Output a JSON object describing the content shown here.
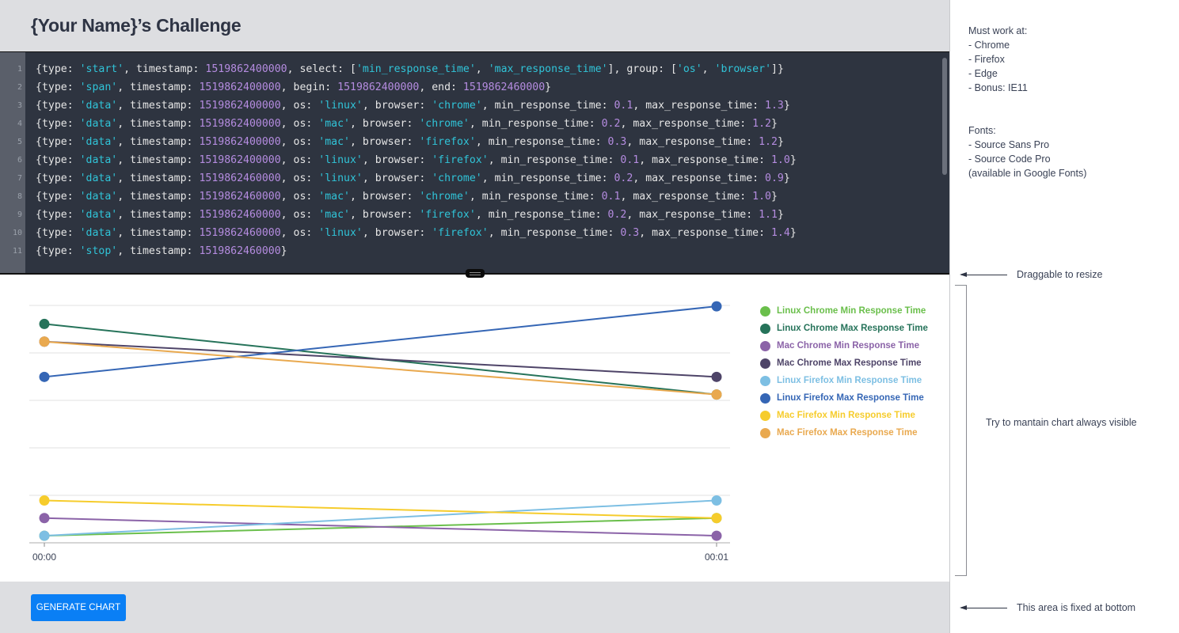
{
  "header": {
    "title": "{Your Name}’s Challenge"
  },
  "editor": {
    "lines": [
      [
        [
          "p",
          "{type: "
        ],
        [
          "s",
          "'start'"
        ],
        [
          "p",
          ", timestamp: "
        ],
        [
          "n",
          "1519862400000"
        ],
        [
          "p",
          ", select: ["
        ],
        [
          "s",
          "'min_response_time'"
        ],
        [
          "p",
          ", "
        ],
        [
          "s",
          "'max_response_time'"
        ],
        [
          "p",
          "], group: ["
        ],
        [
          "s",
          "'os'"
        ],
        [
          "p",
          ", "
        ],
        [
          "s",
          "'browser'"
        ],
        [
          "p",
          "]}"
        ]
      ],
      [
        [
          "p",
          "{type: "
        ],
        [
          "s",
          "'span'"
        ],
        [
          "p",
          ", timestamp: "
        ],
        [
          "n",
          "1519862400000"
        ],
        [
          "p",
          ", begin: "
        ],
        [
          "n",
          "1519862400000"
        ],
        [
          "p",
          ", end: "
        ],
        [
          "n",
          "1519862460000"
        ],
        [
          "p",
          "}"
        ]
      ],
      [
        [
          "p",
          "{type: "
        ],
        [
          "s",
          "'data'"
        ],
        [
          "p",
          ", timestamp: "
        ],
        [
          "n",
          "1519862400000"
        ],
        [
          "p",
          ", os: "
        ],
        [
          "s",
          "'linux'"
        ],
        [
          "p",
          ", browser: "
        ],
        [
          "s",
          "'chrome'"
        ],
        [
          "p",
          ", min_response_time: "
        ],
        [
          "n",
          "0.1"
        ],
        [
          "p",
          ", max_response_time: "
        ],
        [
          "n",
          "1.3"
        ],
        [
          "p",
          "}"
        ]
      ],
      [
        [
          "p",
          "{type: "
        ],
        [
          "s",
          "'data'"
        ],
        [
          "p",
          ", timestamp: "
        ],
        [
          "n",
          "1519862400000"
        ],
        [
          "p",
          ", os: "
        ],
        [
          "s",
          "'mac'"
        ],
        [
          "p",
          ", browser: "
        ],
        [
          "s",
          "'chrome'"
        ],
        [
          "p",
          ", min_response_time: "
        ],
        [
          "n",
          "0.2"
        ],
        [
          "p",
          ", max_response_time: "
        ],
        [
          "n",
          "1.2"
        ],
        [
          "p",
          "}"
        ]
      ],
      [
        [
          "p",
          "{type: "
        ],
        [
          "s",
          "'data'"
        ],
        [
          "p",
          ", timestamp: "
        ],
        [
          "n",
          "1519862400000"
        ],
        [
          "p",
          ", os: "
        ],
        [
          "s",
          "'mac'"
        ],
        [
          "p",
          ", browser: "
        ],
        [
          "s",
          "'firefox'"
        ],
        [
          "p",
          ", min_response_time: "
        ],
        [
          "n",
          "0.3"
        ],
        [
          "p",
          ", max_response_time: "
        ],
        [
          "n",
          "1.2"
        ],
        [
          "p",
          "}"
        ]
      ],
      [
        [
          "p",
          "{type: "
        ],
        [
          "s",
          "'data'"
        ],
        [
          "p",
          ", timestamp: "
        ],
        [
          "n",
          "1519862400000"
        ],
        [
          "p",
          ", os: "
        ],
        [
          "s",
          "'linux'"
        ],
        [
          "p",
          ", browser: "
        ],
        [
          "s",
          "'firefox'"
        ],
        [
          "p",
          ", min_response_time: "
        ],
        [
          "n",
          "0.1"
        ],
        [
          "p",
          ", max_response_time: "
        ],
        [
          "n",
          "1.0"
        ],
        [
          "p",
          "}"
        ]
      ],
      [
        [
          "p",
          "{type: "
        ],
        [
          "s",
          "'data'"
        ],
        [
          "p",
          ", timestamp: "
        ],
        [
          "n",
          "1519862460000"
        ],
        [
          "p",
          ", os: "
        ],
        [
          "s",
          "'linux'"
        ],
        [
          "p",
          ", browser: "
        ],
        [
          "s",
          "'chrome'"
        ],
        [
          "p",
          ", min_response_time: "
        ],
        [
          "n",
          "0.2"
        ],
        [
          "p",
          ", max_response_time: "
        ],
        [
          "n",
          "0.9"
        ],
        [
          "p",
          "}"
        ]
      ],
      [
        [
          "p",
          "{type: "
        ],
        [
          "s",
          "'data'"
        ],
        [
          "p",
          ", timestamp: "
        ],
        [
          "n",
          "1519862460000"
        ],
        [
          "p",
          ", os: "
        ],
        [
          "s",
          "'mac'"
        ],
        [
          "p",
          ", browser: "
        ],
        [
          "s",
          "'chrome'"
        ],
        [
          "p",
          ", min_response_time: "
        ],
        [
          "n",
          "0.1"
        ],
        [
          "p",
          ", max_response_time: "
        ],
        [
          "n",
          "1.0"
        ],
        [
          "p",
          "}"
        ]
      ],
      [
        [
          "p",
          "{type: "
        ],
        [
          "s",
          "'data'"
        ],
        [
          "p",
          ", timestamp: "
        ],
        [
          "n",
          "1519862460000"
        ],
        [
          "p",
          ", os: "
        ],
        [
          "s",
          "'mac'"
        ],
        [
          "p",
          ", browser: "
        ],
        [
          "s",
          "'firefox'"
        ],
        [
          "p",
          ", min_response_time: "
        ],
        [
          "n",
          "0.2"
        ],
        [
          "p",
          ", max_response_time: "
        ],
        [
          "n",
          "1.1"
        ],
        [
          "p",
          "}"
        ]
      ],
      [
        [
          "p",
          "{type: "
        ],
        [
          "s",
          "'data'"
        ],
        [
          "p",
          ", timestamp: "
        ],
        [
          "n",
          "1519862460000"
        ],
        [
          "p",
          ", os: "
        ],
        [
          "s",
          "'linux'"
        ],
        [
          "p",
          ", browser: "
        ],
        [
          "s",
          "'firefox'"
        ],
        [
          "p",
          ", min_response_time: "
        ],
        [
          "n",
          "0.3"
        ],
        [
          "p",
          ", max_response_time: "
        ],
        [
          "n",
          "1.4"
        ],
        [
          "p",
          "}"
        ]
      ],
      [
        [
          "p",
          "{type: "
        ],
        [
          "s",
          "'stop'"
        ],
        [
          "p",
          ", timestamp: "
        ],
        [
          "n",
          "1519862460000"
        ],
        [
          "p",
          "}"
        ]
      ]
    ]
  },
  "chart_data": {
    "type": "line",
    "title": "",
    "xlabel": "",
    "ylabel": "",
    "x": [
      "00:00",
      "00:01"
    ],
    "ylim": [
      0.06,
      1.405
    ],
    "y_gridlines": [
      0.06,
      0.329,
      0.598,
      0.867,
      1.136,
      1.405
    ],
    "grid": true,
    "legend": "right",
    "series": [
      {
        "name": "Linux Chrome Min Response Time",
        "color": "#6abf4b",
        "values": [
          0.1,
          0.2
        ]
      },
      {
        "name": "Linux Chrome Max Response Time",
        "color": "#26735a",
        "values": [
          1.3,
          0.9
        ]
      },
      {
        "name": "Mac Chrome Min Response Time",
        "color": "#8b63a8",
        "values": [
          0.2,
          0.1
        ]
      },
      {
        "name": "Mac Chrome Max Response Time",
        "color": "#4e4468",
        "values": [
          1.2,
          1.0
        ]
      },
      {
        "name": "Linux Firefox Min Response Time",
        "color": "#7dbfe3",
        "values": [
          0.1,
          0.3
        ]
      },
      {
        "name": "Linux Firefox Max Response Time",
        "color": "#3566b5",
        "values": [
          1.0,
          1.4
        ]
      },
      {
        "name": "Mac Firefox Min Response Time",
        "color": "#f6cc2c",
        "values": [
          0.3,
          0.2
        ]
      },
      {
        "name": "Mac Firefox Max Response Time",
        "color": "#e9a94f",
        "values": [
          1.2,
          0.9
        ]
      }
    ]
  },
  "footer": {
    "generate_label": "GENERATE CHART"
  },
  "notes": {
    "browsers": "Must work at:\n- Chrome\n- Firefox\n- Edge\n- Bonus: IE11",
    "fonts": "Fonts:\n- Source Sans Pro\n- Source Code Pro\n(available in Google Fonts)",
    "resize": "Draggable to resize",
    "visible": "Try to mantain chart always visible",
    "fixed": "This area is fixed at bottom"
  }
}
